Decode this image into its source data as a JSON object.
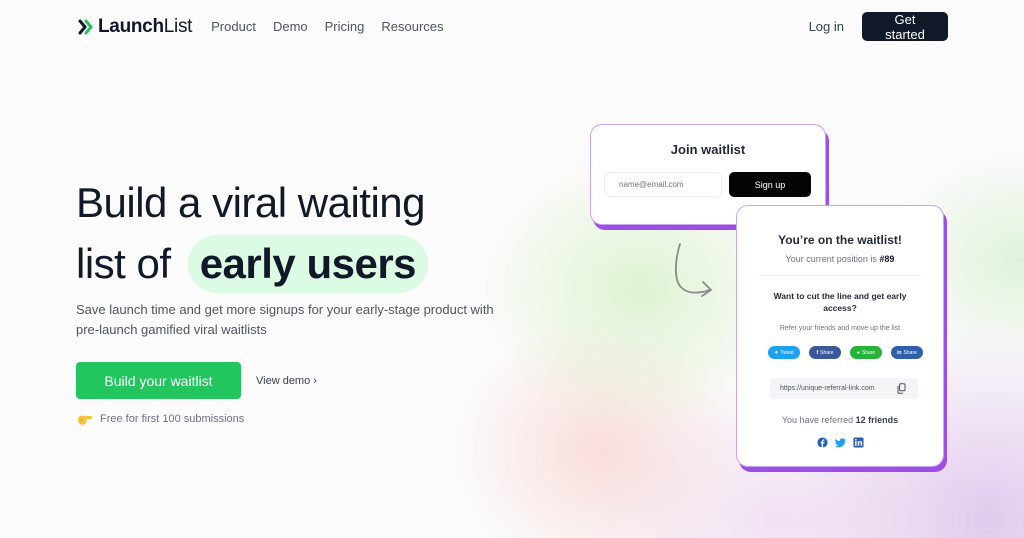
{
  "nav": {
    "logo_bold": "Launch",
    "logo_light": "List",
    "links": [
      "Product",
      "Demo",
      "Pricing",
      "Resources"
    ],
    "login": "Log in",
    "get_started": "Get started"
  },
  "hero": {
    "title_line1": "Build a viral waiting",
    "title_line2_prefix": "list of",
    "title_highlight": "early users",
    "subtitle": "Save launch time and get more signups for your early-stage product with pre-launch gamified viral waitlists",
    "cta_primary": "Build your waitlist",
    "cta_secondary": "View demo ›",
    "free_note": "Free for first 100 submissions",
    "free_icon": "pointing-hand-icon"
  },
  "join_card": {
    "title": "Join waitlist",
    "email_placeholder": "name@email.com",
    "signup_label": "Sign up"
  },
  "success_card": {
    "title": "You’re on the waitlist!",
    "position_prefix": "Your current position is",
    "position_value": "#89",
    "cut_line": "Want to cut the line and get early access?",
    "refer_text": "Refer your friends and move up the list",
    "share_buttons": [
      {
        "label": "Tweet",
        "icon": "twitter-icon",
        "color": "#1da1f2"
      },
      {
        "label": "Share",
        "icon": "facebook-icon",
        "color": "#3b5998"
      },
      {
        "label": "Share",
        "icon": "whatsapp-icon",
        "color": "#25b33a"
      },
      {
        "label": "Share",
        "icon": "linkedin-icon",
        "color": "#2e5fa8"
      }
    ],
    "referral_link": "https://unique-referral-link.com",
    "referred_prefix": "You have referred",
    "referred_value": "12 friends",
    "social_icons": [
      "facebook-icon",
      "twitter-icon",
      "linkedin-icon"
    ]
  },
  "colors": {
    "brand_green": "#22c55e",
    "highlight_bg": "#dcfbe4",
    "card_accent": "#9c4fe6",
    "dark": "#111827"
  }
}
